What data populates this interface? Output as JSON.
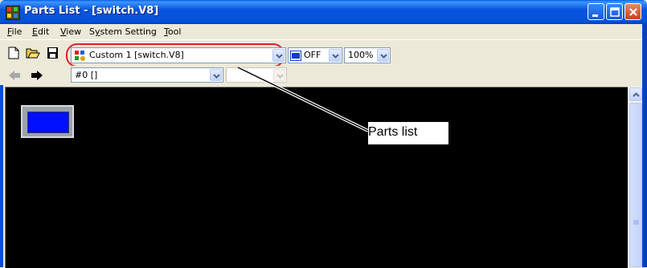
{
  "window": {
    "title": "Parts List - [switch.V8]"
  },
  "menu": [
    {
      "label": "File",
      "accel": "F",
      "rest": "ile"
    },
    {
      "label": "Edit",
      "accel": "E",
      "rest": "dit"
    },
    {
      "label": "View",
      "accel": "V",
      "rest": "iew"
    },
    {
      "label": "System Setting",
      "pre": "S",
      "accel": "y",
      "rest": "stem Setting"
    },
    {
      "label": "Tool",
      "accel": "T",
      "rest": "ool"
    }
  ],
  "toolbar": {
    "parts_combo": "Custom 1 [switch.V8]",
    "state_combo": "OFF",
    "zoom_combo": "100%",
    "screen_combo": "#0 []",
    "empty_combo": ""
  },
  "annotation": {
    "callout_text": "Parts list"
  },
  "colors": {
    "highlight": "#e0202a",
    "canvas": "#000000",
    "part_fill": "#0010ff"
  }
}
